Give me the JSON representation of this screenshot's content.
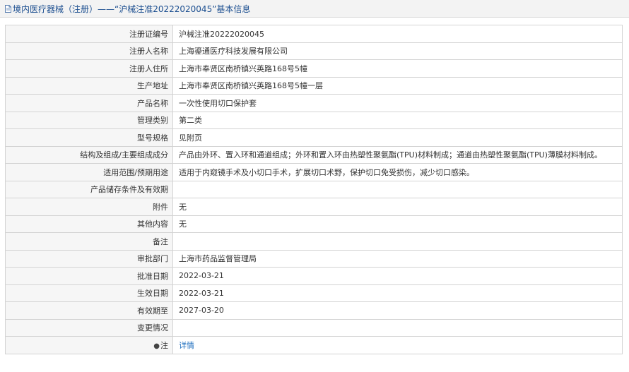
{
  "header": {
    "title": "境内医疗器械（注册）——“沪械注准20222020045”基本信息"
  },
  "rows": [
    {
      "label": "注册证编号",
      "value": "沪械注准20222020045"
    },
    {
      "label": "注册人名称",
      "value": "上海鎏通医疗科技发展有限公司"
    },
    {
      "label": "注册人住所",
      "value": "上海市奉贤区南桥镇兴英路168号5幢"
    },
    {
      "label": "生产地址",
      "value": "上海市奉贤区南桥镇兴英路168号5幢一层"
    },
    {
      "label": "产品名称",
      "value": "一次性使用切口保护套"
    },
    {
      "label": "管理类别",
      "value": "第二类"
    },
    {
      "label": "型号规格",
      "value": "见附页"
    },
    {
      "label": "结构及组成/主要组成成分",
      "value": "产品由外环、置入环和通道组成；外环和置入环由热塑性聚氨酯(TPU)材料制成；通道由热塑性聚氨酯(TPU)薄膜材料制成。"
    },
    {
      "label": "适用范围/预期用途",
      "value": "适用于内窥镜手术及小切口手术，扩展切口术野，保护切口免受损伤，减少切口感染。"
    },
    {
      "label": "产品储存条件及有效期",
      "value": ""
    },
    {
      "label": "附件",
      "value": "无"
    },
    {
      "label": "其他内容",
      "value": "无"
    },
    {
      "label": "备注",
      "value": ""
    },
    {
      "label": "审批部门",
      "value": "上海市药品监督管理局"
    },
    {
      "label": "批准日期",
      "value": "2022-03-21"
    },
    {
      "label": "生效日期",
      "value": "2022-03-21"
    },
    {
      "label": "有效期至",
      "value": "2027-03-20"
    },
    {
      "label": "变更情况",
      "value": ""
    }
  ],
  "note_row": {
    "icon": "pin-icon",
    "label": "注",
    "link_text": "详情"
  },
  "colors": {
    "title_text": "#1a4d8f",
    "link": "#1f6fbf",
    "label_bg": "#f6f6f6",
    "border": "#d3d3d3"
  }
}
